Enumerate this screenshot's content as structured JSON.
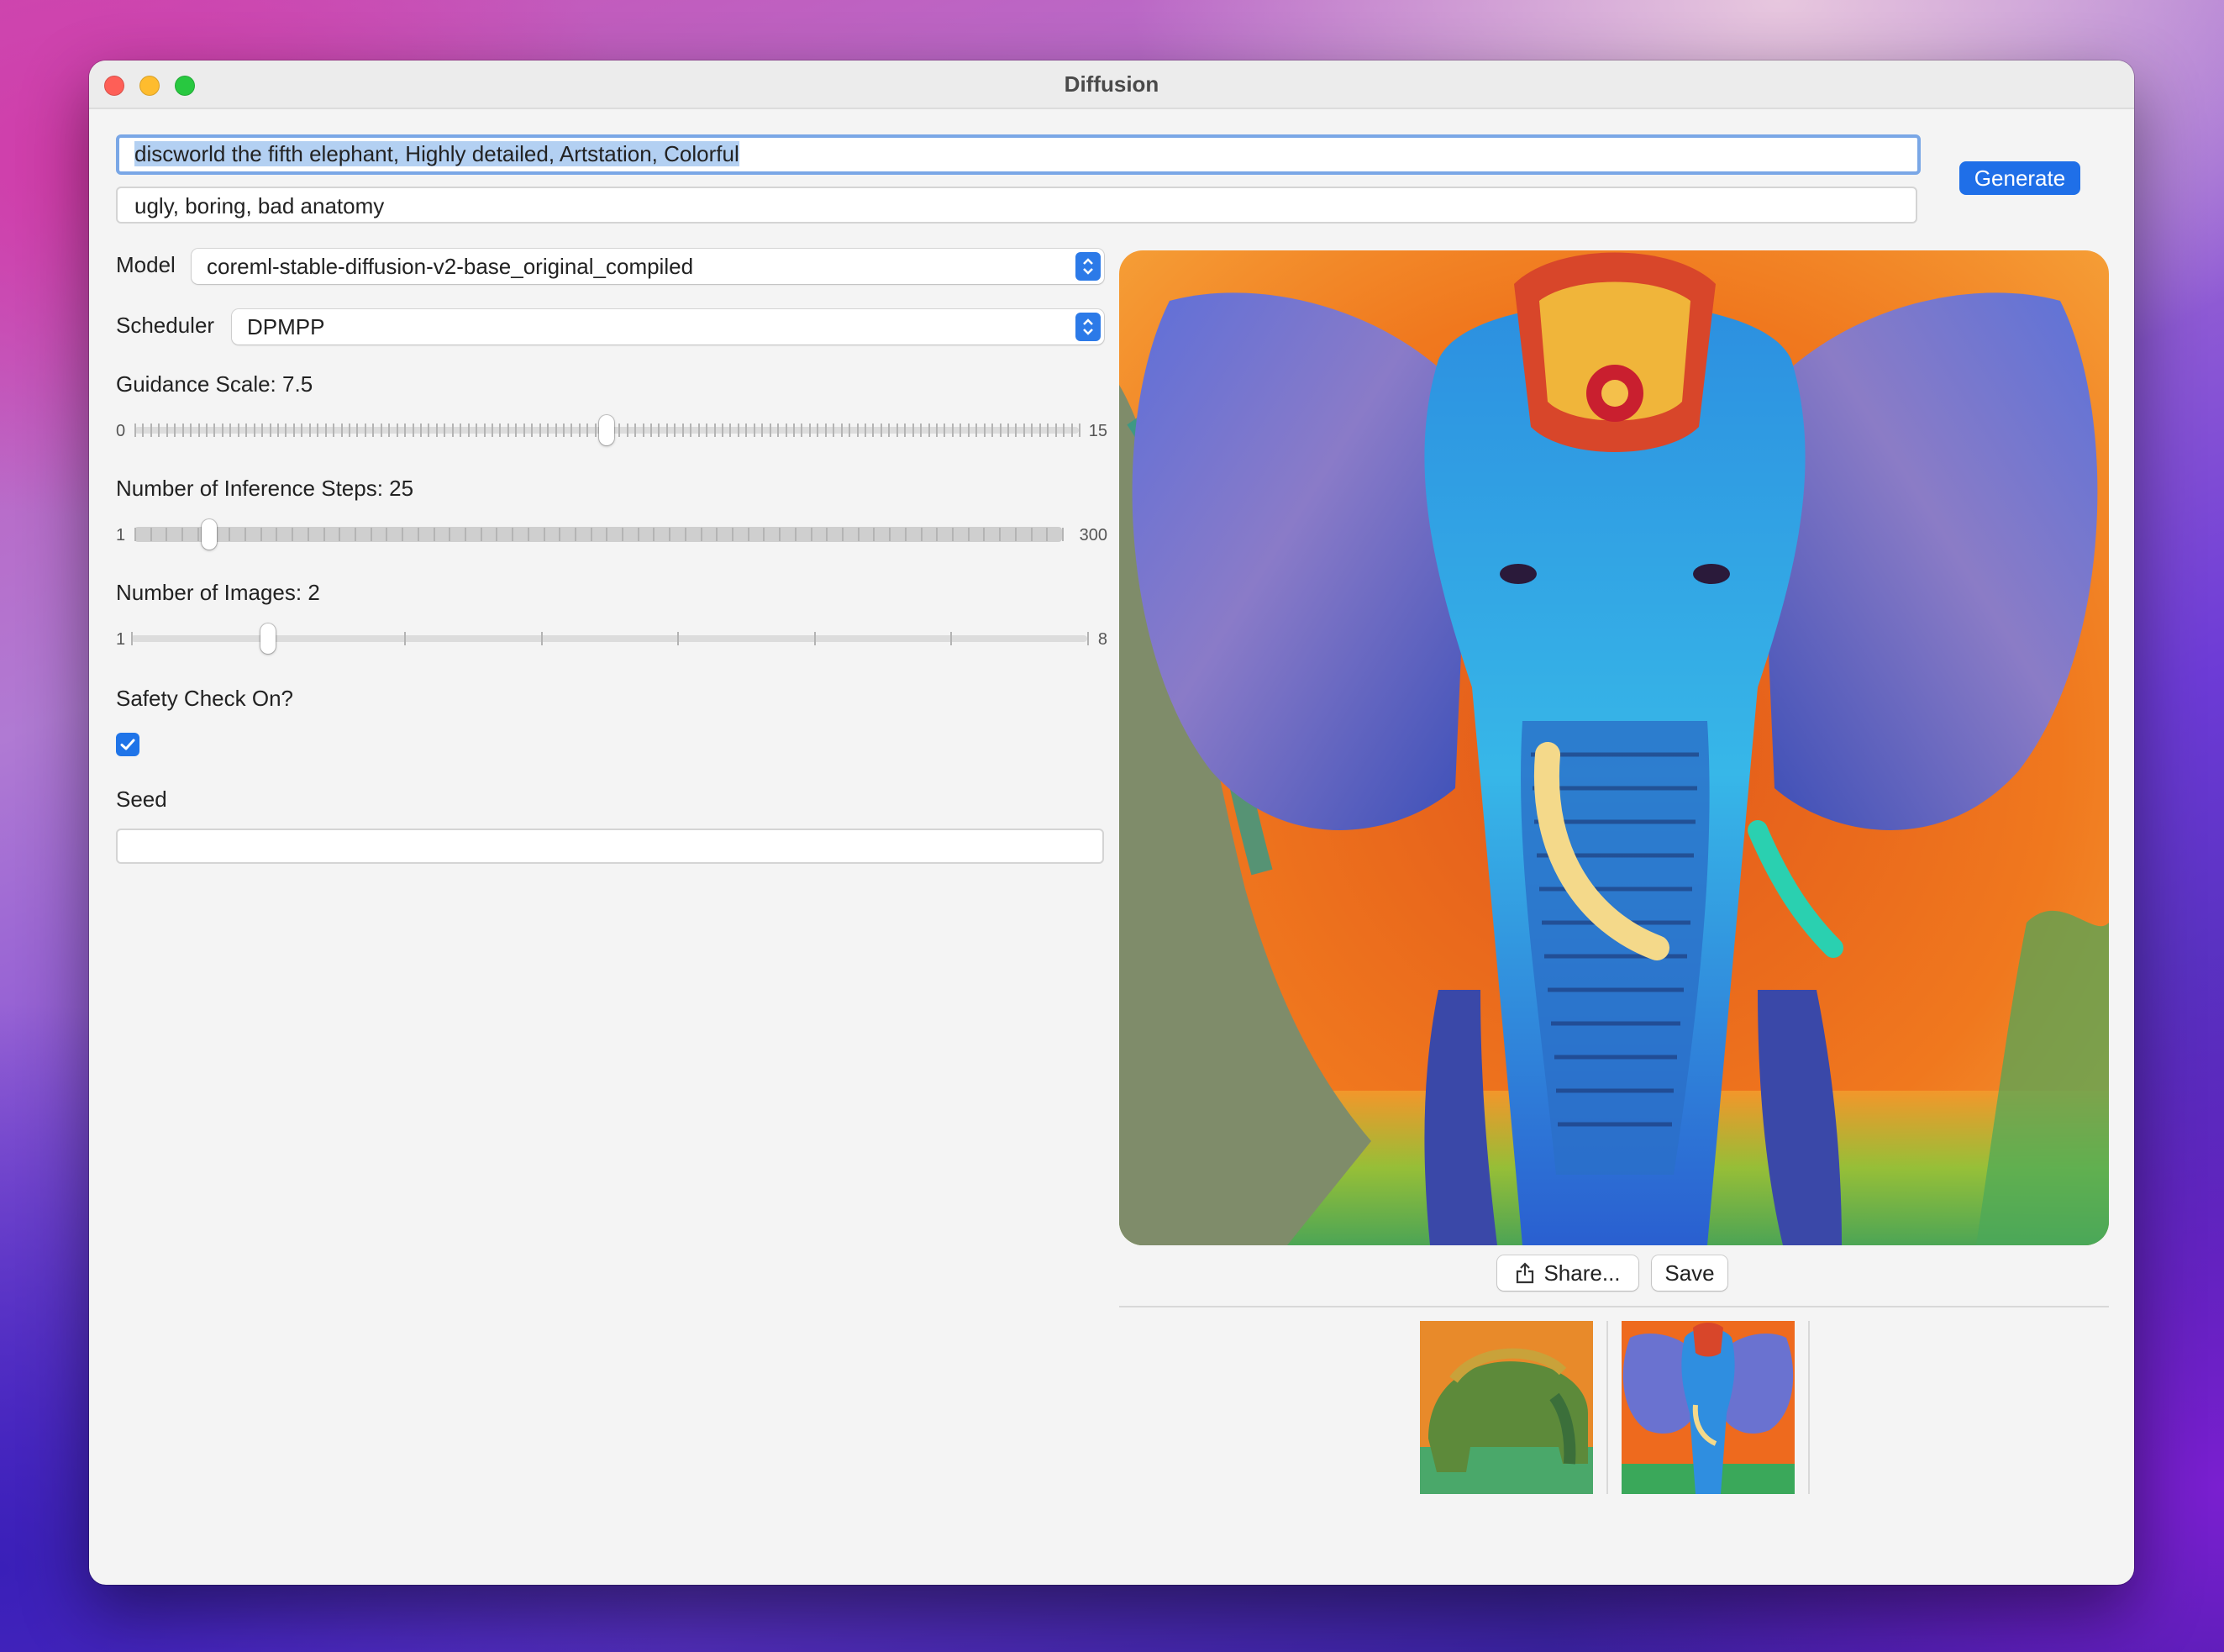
{
  "window": {
    "title": "Diffusion"
  },
  "prompt": {
    "value": "discworld the fifth elephant, Highly detailed, Artstation, Colorful"
  },
  "negative_prompt": {
    "value": "ugly, boring, bad anatomy"
  },
  "generate_label": "Generate",
  "model": {
    "label": "Model",
    "selected": "coreml-stable-diffusion-v2-base_original_compiled"
  },
  "scheduler": {
    "label": "Scheduler",
    "selected": "DPMPP"
  },
  "guidance": {
    "label": "Guidance Scale: 7.5",
    "min": "0",
    "max": "15",
    "value": 7.5,
    "range": [
      0,
      15
    ]
  },
  "steps": {
    "label": "Number of Inference Steps: 25",
    "min": "1",
    "max": "300",
    "value": 25,
    "range": [
      1,
      300
    ]
  },
  "images": {
    "label": "Number of Images: 2",
    "min": "1",
    "max": "8",
    "value": 2,
    "range": [
      1,
      8
    ]
  },
  "safety": {
    "label": "Safety Check On?",
    "checked": true
  },
  "seed": {
    "label": "Seed",
    "value": ""
  },
  "actions": {
    "share_label": "Share...",
    "save_label": "Save"
  },
  "colors": {
    "accent": "#1f6fe8",
    "selection": "#b3d0f2"
  },
  "icons": {
    "share": "share-icon",
    "check": "checkmark-icon",
    "stepper": "chevron-updown-icon"
  }
}
